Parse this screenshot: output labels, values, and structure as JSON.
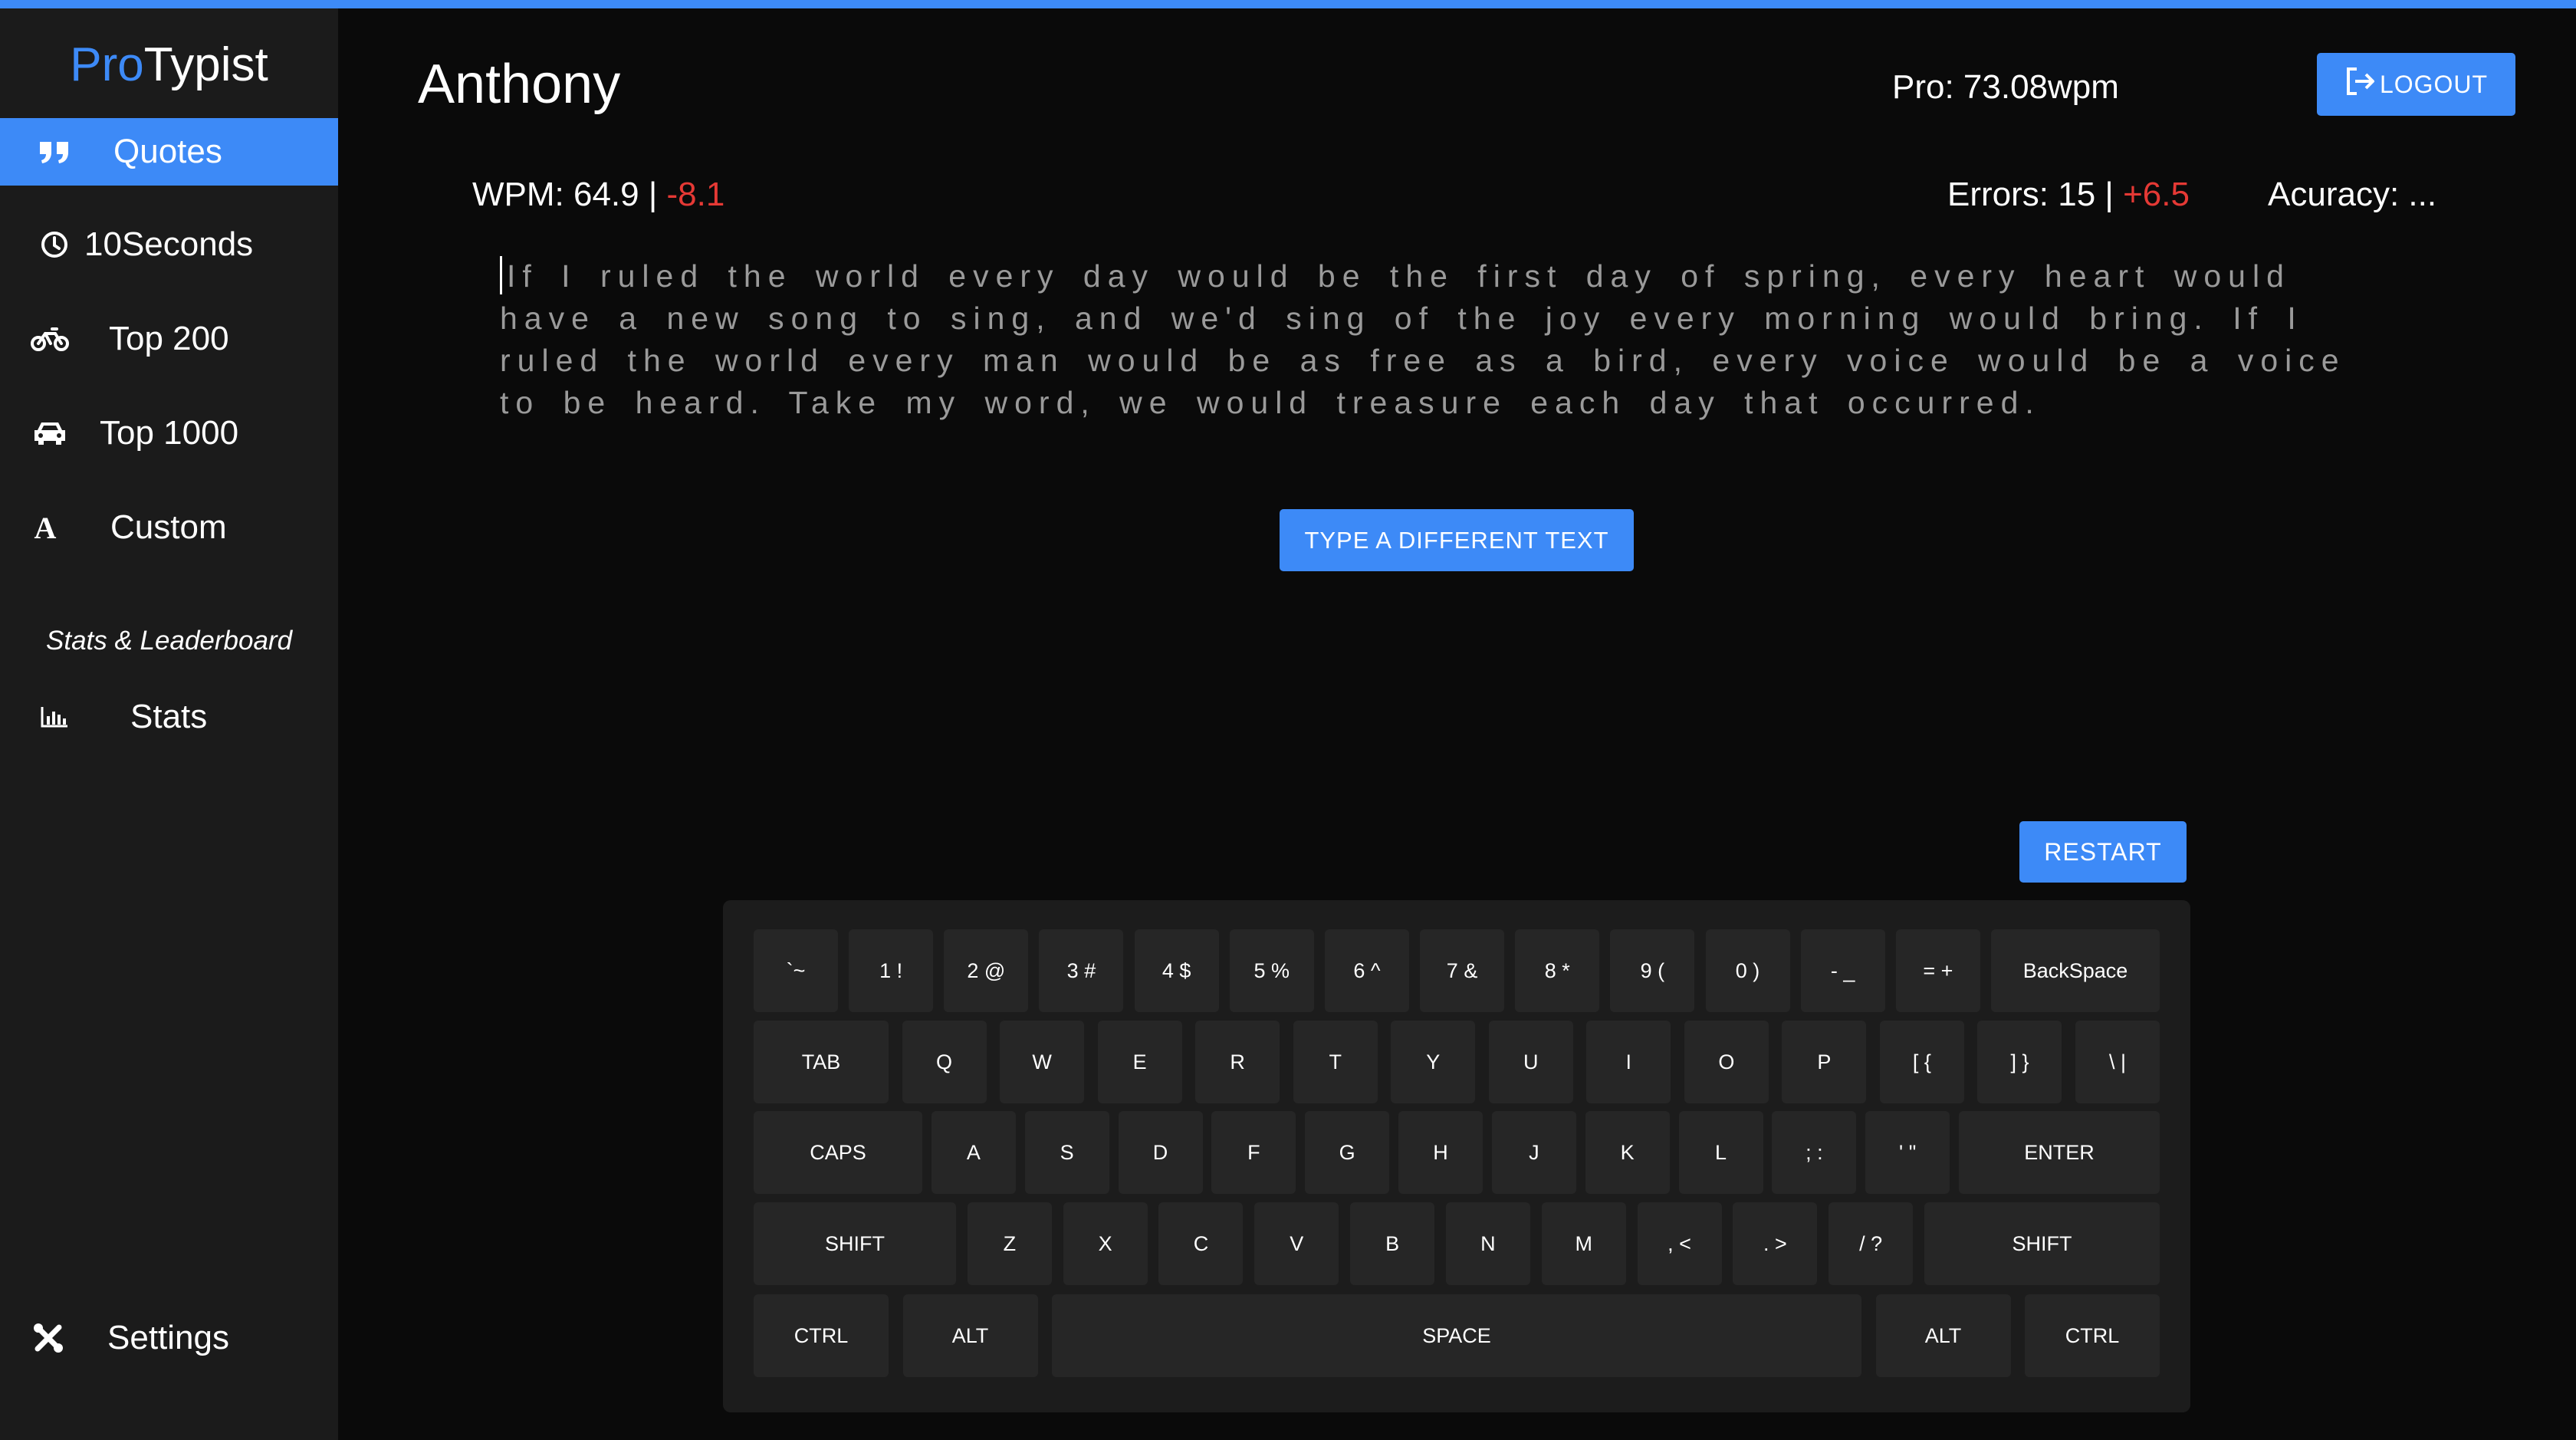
{
  "brand": {
    "pro": "Pro",
    "typist": "Typist"
  },
  "sidebar": {
    "items": [
      {
        "label": "Quotes",
        "icon": "quote-icon",
        "active": true
      },
      {
        "label": "10Seconds",
        "icon": "clock-icon"
      },
      {
        "label": "Top 200",
        "icon": "bicycle-icon"
      },
      {
        "label": "Top 1000",
        "icon": "car-icon"
      },
      {
        "label": "Custom",
        "icon": "letter-a-icon"
      }
    ],
    "section_label": "Stats & Leaderboard",
    "stats": {
      "label": "Stats",
      "icon": "bar-chart-icon"
    },
    "settings": {
      "label": "Settings",
      "icon": "tools-icon"
    }
  },
  "header": {
    "username": "Anthony",
    "pro_wpm": "Pro: 73.08wpm",
    "logout_label": "LOGOUT"
  },
  "stats": {
    "wpm_label": "WPM: 64.9 |",
    "wpm_delta": "-8.1",
    "errors_label": "Errors: 15 |",
    "errors_delta": "+6.5",
    "accuracy_label": "Acuracy: ..."
  },
  "quote": {
    "text": "If I ruled the world every day would be the first day of spring, every heart would have a new song to sing, and we'd sing of the joy every morning would bring. If I ruled the world every man would be as free as a bird, every voice would be a voice to be heard. Take my word, we would treasure each day that occurred."
  },
  "buttons": {
    "different_text": "TYPE A DIFFERENT TEXT",
    "restart": "RESTART"
  },
  "keyboard": {
    "rows": [
      [
        "`~",
        "1 !",
        "2 @",
        "3 #",
        "4 $",
        "5 %",
        "6 ^",
        "7 &",
        "8 *",
        "9 (",
        "0 )",
        "- _",
        "= +",
        "BackSpace"
      ],
      [
        "TAB",
        "Q",
        "W",
        "E",
        "R",
        "T",
        "Y",
        "U",
        "I",
        "O",
        "P",
        "[ {",
        "] }",
        "\\ |"
      ],
      [
        "CAPS",
        "A",
        "S",
        "D",
        "F",
        "G",
        "H",
        "J",
        "K",
        "L",
        "; :",
        "' \"",
        "ENTER"
      ],
      [
        "SHIFT",
        "Z",
        "X",
        "C",
        "V",
        "B",
        "N",
        "M",
        ", <",
        ". >",
        "/ ?",
        "SHIFT"
      ],
      [
        "CTRL",
        "ALT",
        "SPACE",
        "ALT",
        "CTRL"
      ]
    ]
  },
  "colors": {
    "accent": "#3d8af7",
    "negative": "#e53935",
    "sidebar_bg": "#1b1b1b",
    "background": "#0a0a0a",
    "key_bg": "#262626",
    "quote_text": "#9a9a9a"
  }
}
